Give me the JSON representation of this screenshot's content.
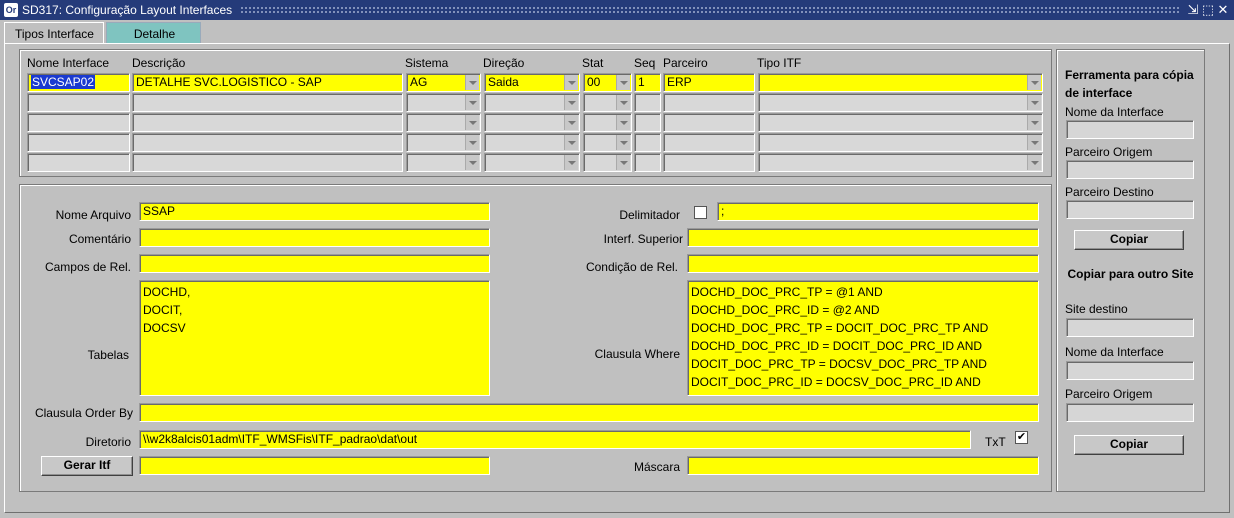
{
  "window": {
    "title": "SD317: Configuração Layout Interfaces",
    "app_icon": "Or"
  },
  "tabs": [
    {
      "label": "Tipos Interface"
    },
    {
      "label": "Detalhe"
    }
  ],
  "grid": {
    "headers": {
      "nome": "Nome Interface",
      "descricao": "Descrição",
      "sistema": "Sistema",
      "direcao": "Direção",
      "stat": "Stat",
      "seq": "Seq",
      "parceiro": "Parceiro",
      "tipo": "Tipo ITF"
    },
    "row1": {
      "nome": "SVCSAP02",
      "descricao": "DETALHE SVC.LOGISTICO - SAP",
      "sistema": "AG",
      "direcao": "Saida",
      "stat": "00",
      "seq": "1",
      "parceiro": "ERP",
      "tipo": ""
    }
  },
  "detail": {
    "nome_arquivo_label": "Nome Arquivo",
    "nome_arquivo": "SSAP",
    "comentario_label": "Comentário",
    "comentario": "",
    "campos_rel_label": "Campos de Rel.",
    "campos_rel": "",
    "tabelas_label": "Tabelas",
    "tabelas": "DOCHD,\nDOCIT,\nDOCSV",
    "delimitador_label": "Delimitador",
    "delimitador": ";",
    "interf_superior_label": "Interf. Superior",
    "interf_superior": "",
    "condicao_rel_label": "Condição de Rel.",
    "condicao_rel": "",
    "clausula_where_label": "Clausula Where",
    "clausula_where": "DOCHD_DOC_PRC_TP = @1 AND\nDOCHD_DOC_PRC_ID = @2 AND\nDOCHD_DOC_PRC_TP = DOCIT_DOC_PRC_TP AND\nDOCHD_DOC_PRC_ID = DOCIT_DOC_PRC_ID AND\nDOCIT_DOC_PRC_TP = DOCSV_DOC_PRC_TP AND\nDOCIT_DOC_PRC_ID = DOCSV_DOC_PRC_ID AND",
    "clausula_order_label": "Clausula Order By",
    "clausula_order": "",
    "diretorio_label": "Diretorio",
    "diretorio": "\\\\w2k8alcis01adm\\ITF_WMSFis\\ITF_padrao\\dat\\out",
    "txt_label": "TxT",
    "txt_checked": "✔",
    "gerar_itf_label": "Gerar Itf",
    "gerar_itf_value": "",
    "mascara_label": "Máscara",
    "mascara": ""
  },
  "copy_tool": {
    "title": "Ferramenta para cópia de interface",
    "nome_label": "Nome da Interface",
    "parceiro_origem_label": "Parceiro Origem",
    "parceiro_destino_label": "Parceiro Destino",
    "copiar_label": "Copiar",
    "other_site_title": "Copiar para outro Site",
    "site_destino_label": "Site destino",
    "nome2_label": "Nome da Interface",
    "parceiro_origem2_label": "Parceiro Origem",
    "copiar2_label": "Copiar"
  },
  "colors": {
    "titlebar": "#253b7a",
    "field_active": "#ffff00",
    "tab_inactive": "#7fc4c0",
    "selection": "#1a3ad0"
  }
}
